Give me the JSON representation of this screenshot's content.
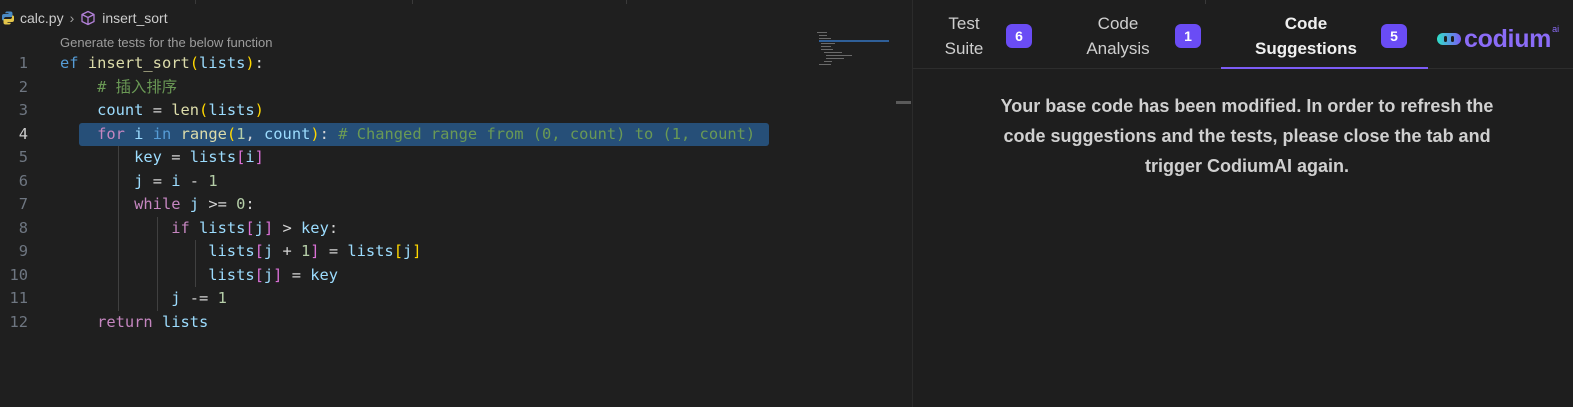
{
  "editor": {
    "breadcrumb": {
      "file": "calc.py",
      "symbol": "insert_sort"
    },
    "codelens": "Generate tests for the below function",
    "active_line": 4,
    "lines": [
      {
        "n": "1",
        "tokens": [
          [
            "kb",
            "ef "
          ],
          [
            "fn",
            "insert_sort"
          ],
          [
            "br",
            "("
          ],
          [
            "vr",
            "lists"
          ],
          [
            "br",
            ")"
          ],
          [
            "op",
            ":"
          ]
        ]
      },
      {
        "n": "2",
        "tokens": [
          [
            "op",
            "    "
          ],
          [
            "cm",
            "# 插入排序"
          ]
        ]
      },
      {
        "n": "3",
        "tokens": [
          [
            "op",
            "    "
          ],
          [
            "vr",
            "count"
          ],
          [
            "op",
            " = "
          ],
          [
            "fn",
            "len"
          ],
          [
            "br",
            "("
          ],
          [
            "vr",
            "lists"
          ],
          [
            "br",
            ")"
          ]
        ]
      },
      {
        "n": "4",
        "tokens": [
          [
            "op",
            "    "
          ],
          [
            "kw",
            "for"
          ],
          [
            "op",
            " "
          ],
          [
            "vr",
            "i"
          ],
          [
            "op",
            " "
          ],
          [
            "kb",
            "in"
          ],
          [
            "op",
            " "
          ],
          [
            "fn",
            "range"
          ],
          [
            "br",
            "("
          ],
          [
            "nm",
            "1"
          ],
          [
            "op",
            ", "
          ],
          [
            "vr",
            "count"
          ],
          [
            "br",
            ")"
          ],
          [
            "op",
            ": "
          ],
          [
            "cm",
            "# Changed range from (0, count) to (1, count)"
          ]
        ]
      },
      {
        "n": "5",
        "tokens": [
          [
            "op",
            "        "
          ],
          [
            "vr",
            "key"
          ],
          [
            "op",
            " = "
          ],
          [
            "vr",
            "lists"
          ],
          [
            "br2",
            "["
          ],
          [
            "vr",
            "i"
          ],
          [
            "br2",
            "]"
          ]
        ]
      },
      {
        "n": "6",
        "tokens": [
          [
            "op",
            "        "
          ],
          [
            "vr",
            "j"
          ],
          [
            "op",
            " = "
          ],
          [
            "vr",
            "i"
          ],
          [
            "op",
            " - "
          ],
          [
            "nm",
            "1"
          ]
        ]
      },
      {
        "n": "7",
        "tokens": [
          [
            "op",
            "        "
          ],
          [
            "kw",
            "while"
          ],
          [
            "op",
            " "
          ],
          [
            "vr",
            "j"
          ],
          [
            "op",
            " >= "
          ],
          [
            "nm",
            "0"
          ],
          [
            "op",
            ":"
          ]
        ]
      },
      {
        "n": "8",
        "tokens": [
          [
            "op",
            "            "
          ],
          [
            "kw",
            "if"
          ],
          [
            "op",
            " "
          ],
          [
            "vr",
            "lists"
          ],
          [
            "br2",
            "["
          ],
          [
            "vr",
            "j"
          ],
          [
            "br2",
            "]"
          ],
          [
            "op",
            " > "
          ],
          [
            "vr",
            "key"
          ],
          [
            "op",
            ":"
          ]
        ]
      },
      {
        "n": "9",
        "tokens": [
          [
            "op",
            "                "
          ],
          [
            "vr",
            "lists"
          ],
          [
            "br2",
            "["
          ],
          [
            "vr",
            "j"
          ],
          [
            "op",
            " + "
          ],
          [
            "nm",
            "1"
          ],
          [
            "br2",
            "]"
          ],
          [
            "op",
            " = "
          ],
          [
            "vr",
            "lists"
          ],
          [
            "br",
            "["
          ],
          [
            "vr",
            "j"
          ],
          [
            "br",
            "]"
          ]
        ]
      },
      {
        "n": "10",
        "tokens": [
          [
            "op",
            "                "
          ],
          [
            "vr",
            "lists"
          ],
          [
            "br2",
            "["
          ],
          [
            "vr",
            "j"
          ],
          [
            "br2",
            "]"
          ],
          [
            "op",
            " = "
          ],
          [
            "vr",
            "key"
          ]
        ]
      },
      {
        "n": "11",
        "tokens": [
          [
            "op",
            "            "
          ],
          [
            "vr",
            "j"
          ],
          [
            "op",
            " -= "
          ],
          [
            "nm",
            "1"
          ]
        ]
      },
      {
        "n": "12",
        "tokens": [
          [
            "op",
            "    "
          ],
          [
            "kw",
            "return"
          ],
          [
            "op",
            " "
          ],
          [
            "vr",
            "lists"
          ]
        ]
      }
    ]
  },
  "panel": {
    "tabs": [
      {
        "label_line1": "Test",
        "label_line2": "Suite",
        "count": "6",
        "active": false
      },
      {
        "label_line1": "Code",
        "label_line2": "Analysis",
        "count": "1",
        "active": false
      },
      {
        "label_line1": "Code",
        "label_line2": "Suggestions",
        "count": "5",
        "active": true
      }
    ],
    "logo": {
      "text": "codium",
      "superscript": "ai"
    },
    "message": "Your base code has been modified. In order to refresh the code suggestions and the tests, please close the tab and trigger CodiumAI again."
  },
  "colors": {
    "accent": "#6a4cf5",
    "selection": "#264f78",
    "editor_bg": "#1f1f1f"
  },
  "icons": {
    "file": "python-file-icon",
    "symbol": "cube-method-icon",
    "separator": "chevron-right-icon",
    "logo": "codium-logo-icon"
  }
}
